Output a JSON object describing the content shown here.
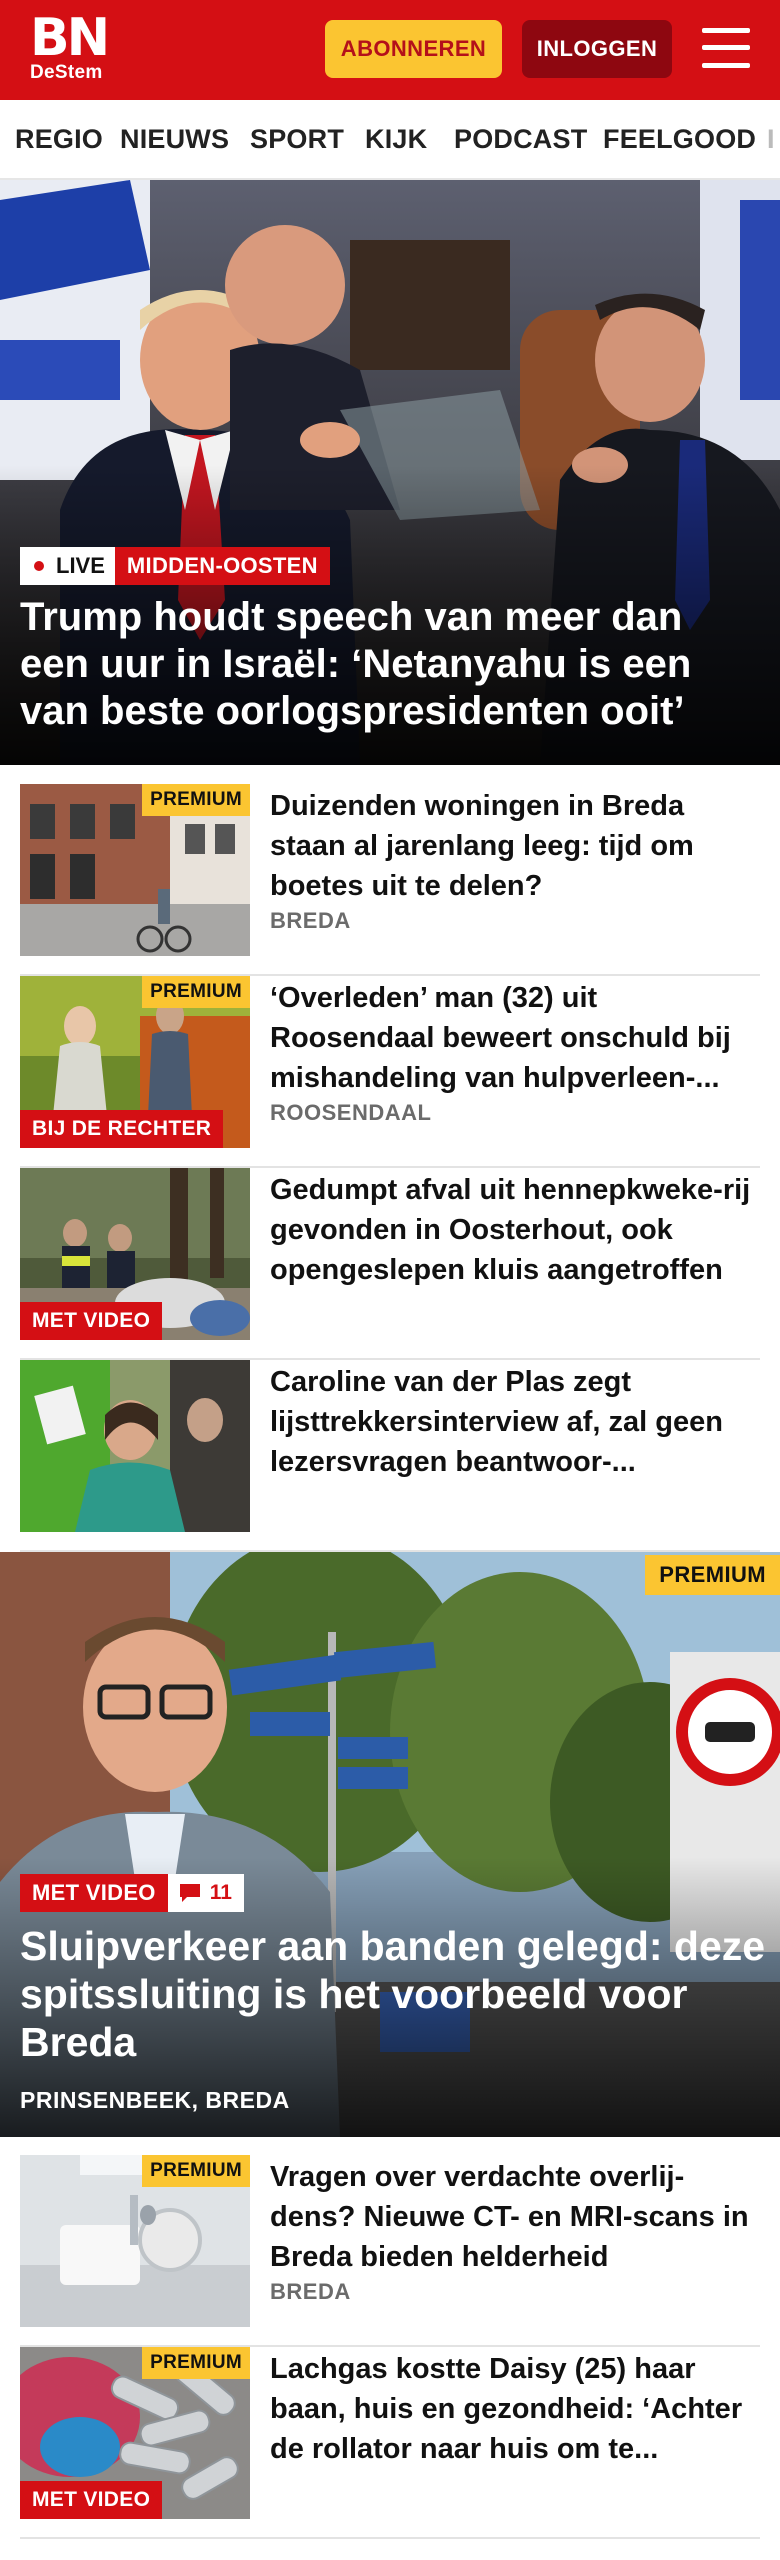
{
  "header": {
    "logo_main": "BN",
    "logo_sub": "DeStem",
    "subscribe_label": "ABONNEREN",
    "login_label": "INLOGGEN",
    "brand_color": "#d40f14"
  },
  "nav": {
    "items": [
      "REGIO",
      "NIEUWS",
      "SPORT",
      "KIJK",
      "PODCAST",
      "FEELGOOD",
      "I"
    ]
  },
  "hero": {
    "live_label": "LIVE",
    "category": "MIDDEN-OOSTEN",
    "title": "Trump houdt speech van meer dan een uur in Israël: ‘Netanyahu is een van beste oorlogspresidenten ooit’"
  },
  "articles": [
    {
      "premium": "PREMIUM",
      "badge": "",
      "title": "Duizenden woningen in Breda staan al jarenlang leeg: tijd om boetes uit te delen?",
      "location": "BREDA"
    },
    {
      "premium": "PREMIUM",
      "badge": "BIJ DE RECHTER",
      "title": "‘Overleden’ man (32) uit Roosendaal beweert onschuld bij mishandeling van hulpverleen-...",
      "location": "ROOSENDAAL"
    },
    {
      "premium": "",
      "badge": "MET VIDEO",
      "title": "Gedumpt afval uit hennepkweke-rij gevonden in Oosterhout, ook opengeslepen kluis aangetroffen",
      "location": ""
    },
    {
      "premium": "",
      "badge": "",
      "title": "Caroline van der Plas zegt lijsttrekkersinterview af, zal geen lezersvragen beantwoor-...",
      "location": ""
    }
  ],
  "feature": {
    "premium": "PREMIUM",
    "badge": "MET VIDEO",
    "comments": "11",
    "title": "Sluipverkeer aan banden gelegd: deze spitssluiting is het voorbeeld voor Breda",
    "location": "PRINSENBEEK, BREDA"
  },
  "articles2": [
    {
      "premium": "PREMIUM",
      "badge": "",
      "title": "Vragen over verdachte overlij-dens? Nieuwe CT- en MRI-scans in Breda bieden helderheid",
      "location": "BREDA"
    },
    {
      "premium": "PREMIUM",
      "badge": "MET VIDEO",
      "title": "Lachgas kostte Daisy (25) haar baan, huis en gezondheid: ‘Achter de rollator naar huis om te...",
      "location": ""
    }
  ]
}
